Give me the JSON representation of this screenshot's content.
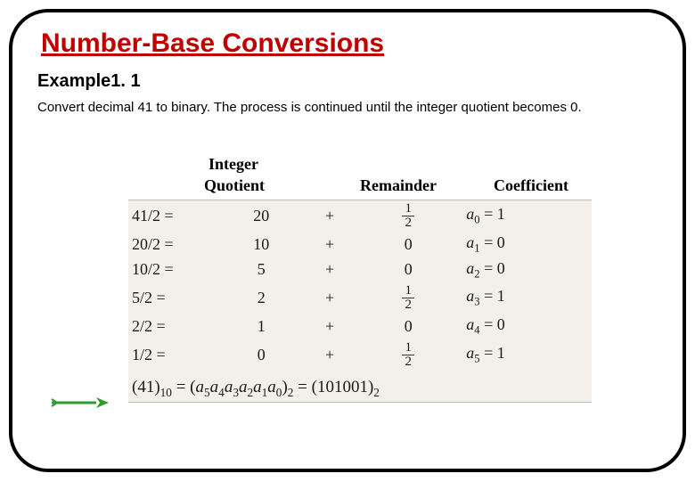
{
  "title": "Number-Base Conversions",
  "subtitle": "Example1. 1",
  "body": "Convert decimal 41 to binary. The process is continued until the integer quotient becomes 0.",
  "headers": {
    "integer": "Integer",
    "quotient": "Quotient",
    "remainder": "Remainder",
    "coefficient": "Coefficient"
  },
  "rows": [
    {
      "expr": "41/2 =",
      "quotient": "20",
      "plus": "+",
      "rem_is_half": true,
      "rem_plain": "",
      "coef_sub": "0",
      "coef_val": "1"
    },
    {
      "expr": "20/2 =",
      "quotient": "10",
      "plus": "+",
      "rem_is_half": false,
      "rem_plain": "0",
      "coef_sub": "1",
      "coef_val": "0"
    },
    {
      "expr": "10/2 =",
      "quotient": "5",
      "plus": "+",
      "rem_is_half": false,
      "rem_plain": "0",
      "coef_sub": "2",
      "coef_val": "0"
    },
    {
      "expr": "5/2 =",
      "quotient": "2",
      "plus": "+",
      "rem_is_half": true,
      "rem_plain": "",
      "coef_sub": "3",
      "coef_val": "1"
    },
    {
      "expr": "2/2 =",
      "quotient": "1",
      "plus": "+",
      "rem_is_half": false,
      "rem_plain": "0",
      "coef_sub": "4",
      "coef_val": "0"
    },
    {
      "expr": "1/2 =",
      "quotient": "0",
      "plus": "+",
      "rem_is_half": true,
      "rem_plain": "",
      "coef_sub": "5",
      "coef_val": "1"
    }
  ],
  "frac": {
    "num": "1",
    "den": "2"
  },
  "coef_prefix": "a",
  "coef_eq": " = ",
  "result": {
    "lhs_open": "(41)",
    "lhs_sub": "10",
    "eq1": " = (",
    "mid_plain": "a",
    "mid_subs": [
      "5",
      "4",
      "3",
      "2",
      "1",
      "0"
    ],
    "mid_close": ")",
    "mid_sub": "2",
    "eq2": " = (101001)",
    "rhs_sub": "2"
  },
  "arrow_color": "#2e9c2e"
}
